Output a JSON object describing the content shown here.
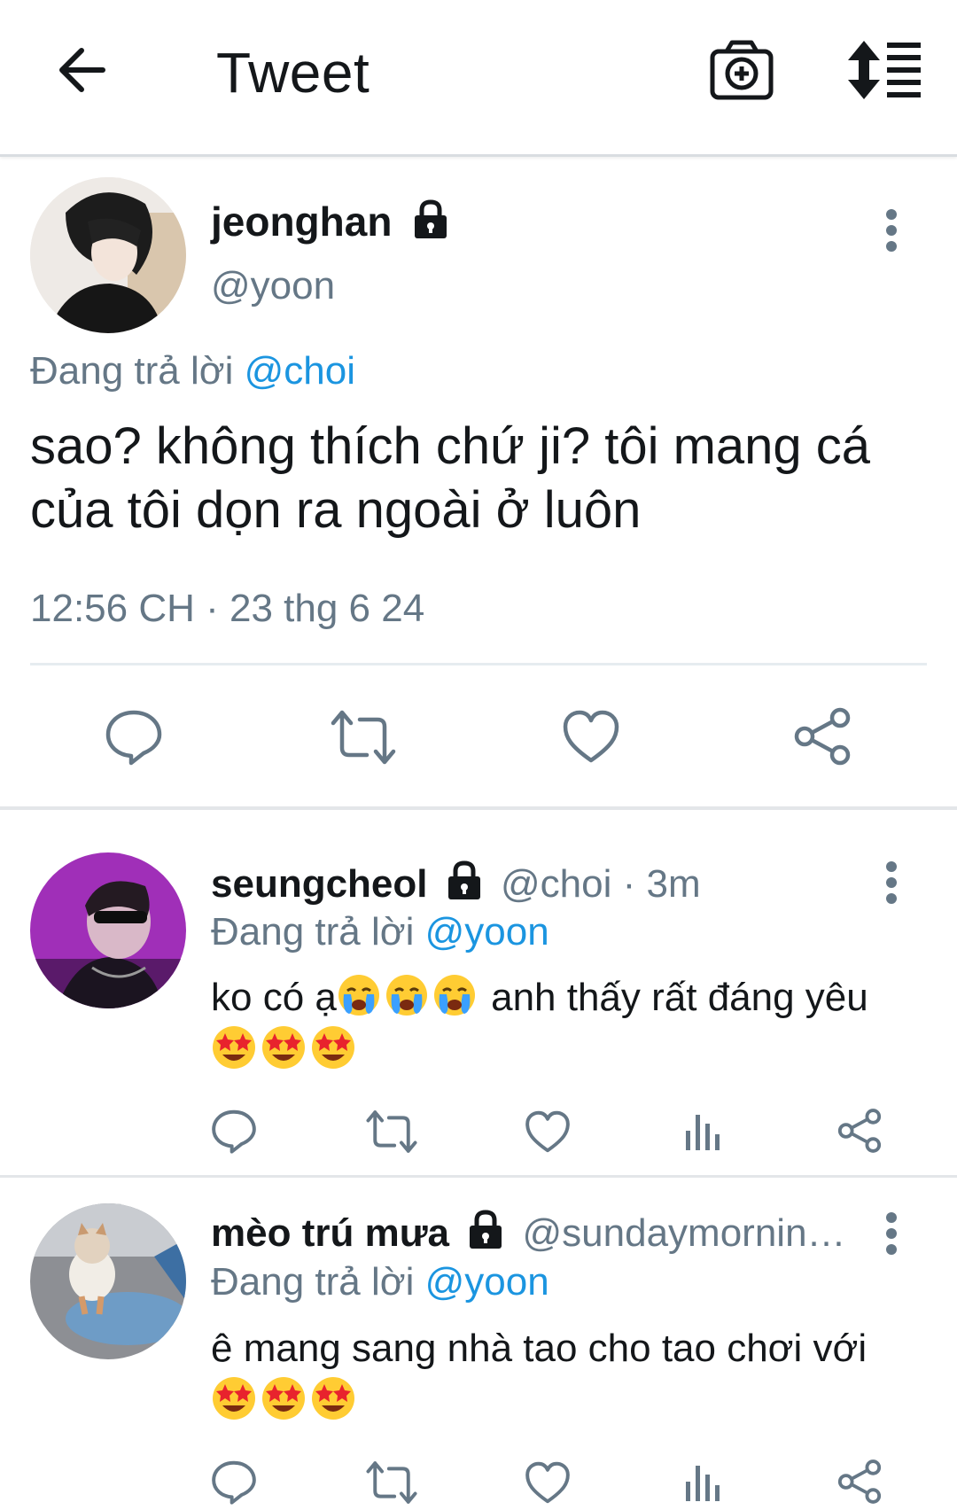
{
  "header": {
    "title": "Tweet",
    "back_icon": "arrow-left-icon",
    "camera_icon": "camera-plus-icon",
    "sort_icon": "sort-list-icon"
  },
  "main_tweet": {
    "display_name": "jeonghan",
    "handle": "@yoon",
    "reply_prefix": "Đang trả lời",
    "reply_to": "@choi",
    "text_line1": "sao? không thích chứ ji? tôi mang cá",
    "text_line2": "của tôi dọn ra ngoài ở luôn",
    "timestamp": "12:56 CH · 23 thg 6 24",
    "actions": [
      "reply-icon",
      "retweet-icon",
      "like-icon",
      "share-icon"
    ]
  },
  "replies": [
    {
      "display_name": "seungcheol",
      "handle": "@choi",
      "time": "· 3m",
      "reply_prefix": "Đang trả lời",
      "reply_to": "@yoon",
      "text_a": "ko có ạ",
      "text_b": " anh thấy rất đáng yêu",
      "emojis_inline": [
        "crying-face",
        "crying-face",
        "crying-face"
      ],
      "emojis_line2": [
        "star-struck",
        "star-struck",
        "star-struck"
      ]
    },
    {
      "display_name": "mèo trú mưa",
      "handle": "@sundaymornin…",
      "reply_prefix": "Đang trả lời",
      "reply_to": "@yoon",
      "text_a": "ê mang sang nhà tao cho tao chơi với",
      "emojis_line2": [
        "star-struck",
        "star-struck",
        "star-struck"
      ]
    }
  ],
  "colors": {
    "link": "#1b95e0",
    "muted": "#657786",
    "text": "#14171a"
  }
}
